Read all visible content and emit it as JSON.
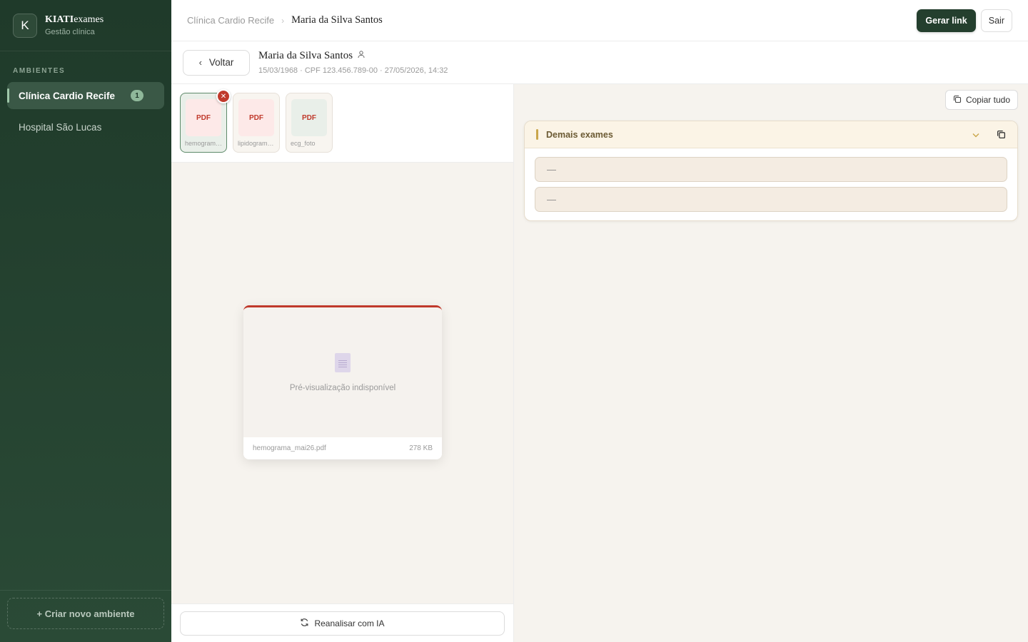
{
  "sidebar": {
    "brand": {
      "logo_letter": "K",
      "name_bold": "KIATI",
      "name_rest": "exames",
      "subtitle": "Gestão clínica"
    },
    "section_label": "AMBIENTES",
    "environments": [
      {
        "label": "Clínica Cardio Recife",
        "badge": "1",
        "active": true
      },
      {
        "label": "Hospital São Lucas",
        "active": false
      }
    ],
    "create_label": "+ Criar novo ambiente"
  },
  "topbar": {
    "breadcrumb": [
      "Clínica Cardio Recife",
      "Maria da Silva Santos"
    ],
    "generate_link_label": "Gerar link",
    "logout_label": "Sair"
  },
  "patient": {
    "back_label": "Voltar",
    "name": "Maria da Silva Santos",
    "meta": "15/03/1968 · CPF 123.456.789-00 · 27/05/2026, 14:32"
  },
  "files": {
    "thumbnails": [
      {
        "type": "PDF",
        "label": "hemogram…",
        "selected": true
      },
      {
        "type": "PDF",
        "label": "lipidogram…",
        "selected": false
      },
      {
        "type": "PDF",
        "label": "ecg_foto",
        "selected": false
      }
    ],
    "preview": {
      "message": "Pré-visualização indisponível",
      "filename": "hemograma_mai26.pdf",
      "size": "278 KB"
    },
    "reanalyze_label": "Reanalisar com IA"
  },
  "results": {
    "copy_all_label": "Copiar tudo",
    "section_title": "Demais exames",
    "fields": [
      "—",
      "—"
    ]
  },
  "colors": {
    "sidebar_bg": "#1f3a2a",
    "primary": "#243f2e",
    "danger": "#c0392b",
    "accent_gold": "#c9a64a"
  }
}
